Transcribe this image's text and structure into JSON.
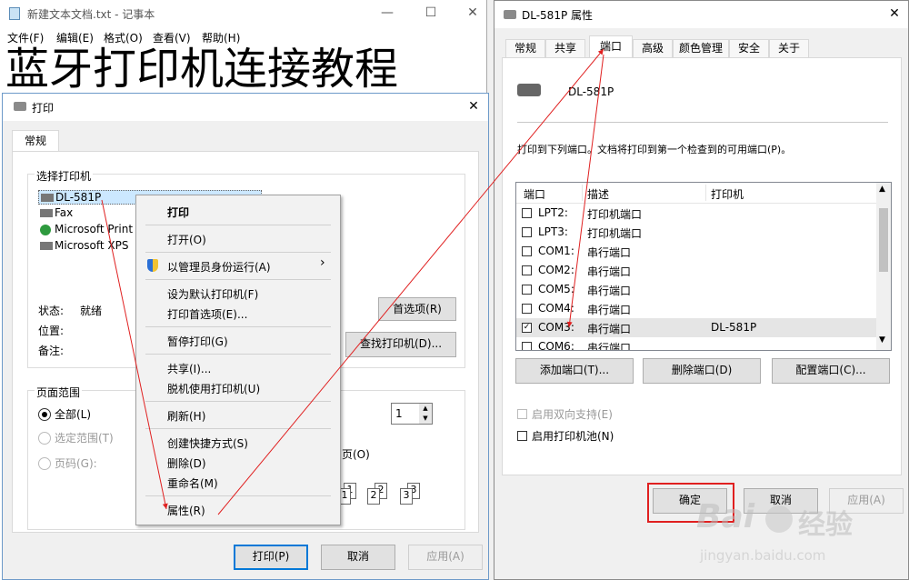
{
  "notepad": {
    "title": "新建文本文档.txt - 记事本",
    "menu": [
      "文件(F)",
      "编辑(E)",
      "格式(O)",
      "查看(V)",
      "帮助(H)"
    ],
    "content": "蓝牙打印机连接教程"
  },
  "print_dialog": {
    "title": "打印",
    "tab": "常规",
    "group_select": "选择打印机",
    "printers": [
      "DL-581P",
      "Fax",
      "Microsoft Print",
      "Microsoft XPS"
    ],
    "status_label": "状态:",
    "status_value": "就绪",
    "location_label": "位置:",
    "comment_label": "备注:",
    "preferences_button": "首选项(R)",
    "find_printer_button": "查找打印机(D)...",
    "page_range_group": "页面范围",
    "range_all": "全部(L)",
    "range_selection": "选定范围(T)",
    "range_pages": "页码(G):",
    "copies_value": "1",
    "collate_partial": "页(O)",
    "collate_icons": [
      "1",
      "1",
      "2",
      "2",
      "3",
      "3"
    ],
    "print_button": "打印(P)",
    "cancel_button": "取消",
    "apply_button": "应用(A)"
  },
  "context_menu": {
    "items": [
      {
        "label": "打印",
        "bold": true
      },
      {
        "label": "打开(O)"
      },
      {
        "label": "以管理员身份运行(A)",
        "shield": true,
        "submenu": true
      },
      {
        "label": "设为默认打印机(F)"
      },
      {
        "label": "打印首选项(E)..."
      },
      {
        "label": "暂停打印(G)"
      },
      {
        "label": "共享(I)..."
      },
      {
        "label": "脱机使用打印机(U)"
      },
      {
        "label": "刷新(H)"
      },
      {
        "label": "创建快捷方式(S)"
      },
      {
        "label": "删除(D)"
      },
      {
        "label": "重命名(M)"
      },
      {
        "label": "属性(R)"
      }
    ]
  },
  "props": {
    "title": "DL-581P 属性",
    "tabs": [
      "常规",
      "共享",
      "端口",
      "高级",
      "颜色管理",
      "安全",
      "关于"
    ],
    "active_tab": "端口",
    "printer_name": "DL-581P",
    "description": "打印到下列端口。文档将打印到第一个检查到的可用端口(P)。",
    "columns": [
      "端口",
      "描述",
      "打印机"
    ],
    "ports": [
      {
        "port": "LPT2:",
        "desc": "打印机端口",
        "printer": "",
        "checked": false
      },
      {
        "port": "LPT3:",
        "desc": "打印机端口",
        "printer": "",
        "checked": false
      },
      {
        "port": "COM1:",
        "desc": "串行端口",
        "printer": "",
        "checked": false
      },
      {
        "port": "COM2:",
        "desc": "串行端口",
        "printer": "",
        "checked": false
      },
      {
        "port": "COM5:",
        "desc": "串行端口",
        "printer": "",
        "checked": false
      },
      {
        "port": "COM4:",
        "desc": "串行端口",
        "printer": "",
        "checked": false
      },
      {
        "port": "COM3:",
        "desc": "串行端口",
        "printer": "DL-581P",
        "checked": true
      },
      {
        "port": "COM6:",
        "desc": "串行端口",
        "printer": "",
        "checked": false
      }
    ],
    "add_port": "添加端口(T)...",
    "delete_port": "删除端口(D)",
    "config_port": "配置端口(C)...",
    "bidirectional": "启用双向支持(E)",
    "pooling": "启用打印机池(N)",
    "ok": "确定",
    "cancel": "取消",
    "apply": "应用(A)"
  },
  "watermark": {
    "brand": "Bai",
    "brand2": "经验",
    "url": "jingyan.baidu.com"
  },
  "colors": {
    "accent": "#0078d7",
    "highlight": "#cce8ff",
    "arrow": "#e02020",
    "ok_highlight": "#e02020"
  }
}
